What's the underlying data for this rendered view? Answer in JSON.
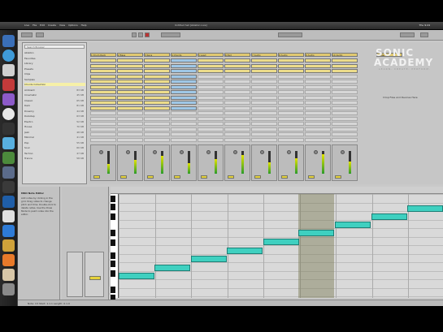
{
  "os_menubar": {
    "menus": [
      "Live",
      "File",
      "Edit",
      "Create",
      "View",
      "Options",
      "Help"
    ],
    "window_title": "Untitled Set  [Ableton Live]",
    "clock": "Thu 9:24"
  },
  "browser": {
    "search_placeholder": "Search Browser",
    "items": [
      {
        "name": "Ableton",
        "size": ""
      },
      {
        "name": "Favorites",
        "size": ""
      },
      {
        "name": "Library",
        "size": ""
      },
      {
        "name": "Presets",
        "size": ""
      },
      {
        "name": "Clips",
        "size": ""
      },
      {
        "name": "Samples",
        "size": ""
      },
      {
        "name": "Chords Collection",
        "size": "",
        "selected": true
      },
      {
        "name": "Ambient",
        "size": "83 KB"
      },
      {
        "name": "Cinematic",
        "size": "45 KB"
      },
      {
        "name": "Classic",
        "size": "65 KB"
      },
      {
        "name": "Dark",
        "size": "81 KB"
      },
      {
        "name": "Dreamy",
        "size": "44 KB"
      },
      {
        "name": "Dubstep",
        "size": "63 KB"
      },
      {
        "name": "Electro",
        "size": "52 KB"
      },
      {
        "name": "House",
        "size": "70 KB"
      },
      {
        "name": "Jazz",
        "size": "48 KB"
      },
      {
        "name": "Minimal",
        "size": "41 KB"
      },
      {
        "name": "Pop",
        "size": "55 KB"
      },
      {
        "name": "Soul",
        "size": "60 KB"
      },
      {
        "name": "Techno",
        "size": "47 KB"
      },
      {
        "name": "Trance",
        "size": "58 KB"
      }
    ]
  },
  "session": {
    "tracks": [
      "1 Drum Rack",
      "2 Bass",
      "3 Keys",
      "4 Chords",
      "5 Lead",
      "6 Pad",
      "7 Audio",
      "8 Audio",
      "9 Audio",
      "10 Audio",
      "Master"
    ],
    "master_hint": "Drop Files and Devices Here"
  },
  "logo": {
    "line1": "SONIC",
    "line2": "ACADEMY",
    "tagline": "LEARN. CREATE. PERFORM."
  },
  "info_panel": {
    "title": "MIDI Note Editor",
    "body": "Add notes by clicking in the grid. Drag notes to change pitch and time. Double-click to delete notes. Use the Draw Mode to paint notes into the editor."
  },
  "status_bar": {
    "text": "Note: C3  Start: 1.1.1  Length: 0.1.0"
  },
  "colors": {
    "note": "#3fd0c0",
    "clip_yellow": "#ecdc8a",
    "clip_blue": "#9fc7e6",
    "selection": "#f6f0a8"
  }
}
